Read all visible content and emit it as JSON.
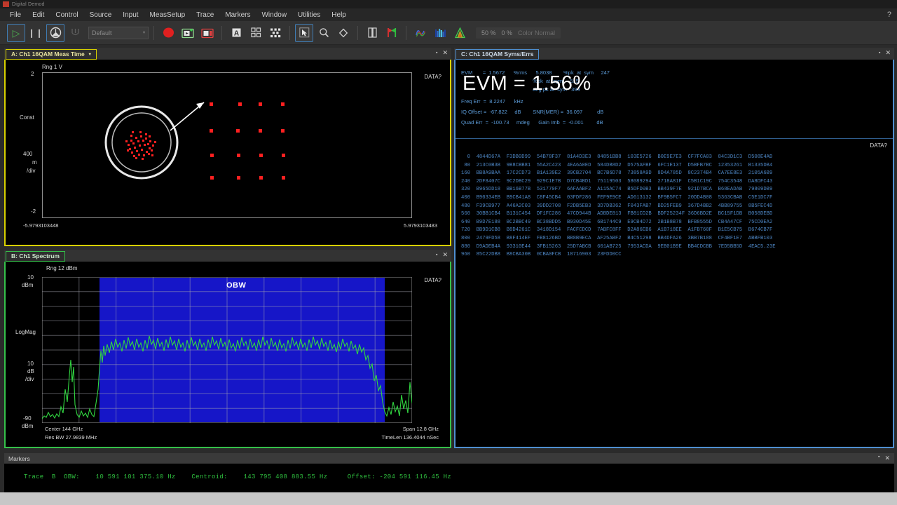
{
  "window": {
    "title": "Digital Demod",
    "logo_color": "#c0392b"
  },
  "menubar": {
    "items": [
      "File",
      "Edit",
      "Control",
      "Source",
      "Input",
      "MeasSetup",
      "Trace",
      "Markers",
      "Window",
      "Utilities",
      "Help"
    ],
    "help_icon": "?"
  },
  "toolbar": {
    "buttons": [
      {
        "name": "run-button",
        "glyph": "▷",
        "selected": true,
        "color": "#4caf50"
      },
      {
        "name": "pause-button",
        "glyph": "❙❙",
        "selected": false,
        "color": "#b8b8b8"
      },
      {
        "name": "single-button",
        "glyph": "⏺",
        "selected": true,
        "color": "#e0e0e0"
      },
      {
        "name": "restart-button",
        "glyph": "⟲",
        "selected": false,
        "color": "#6e6e6e"
      }
    ],
    "preset_combo": {
      "value": "Default",
      "placeholder": "Default",
      "arrow": "▾"
    },
    "record_button": {
      "name": "record-button",
      "glyph": "●",
      "color": "#e02020"
    },
    "capture_button": {
      "name": "capture-button",
      "glyph": "▣",
      "color": "#8fdc8f"
    },
    "stop_record_button": {
      "name": "stop-record-button",
      "glyph": "▣",
      "color": "#e04040"
    },
    "marker_button": {
      "name": "marker-letter-button",
      "glyph": "A"
    },
    "grid_button": {
      "name": "grid-layout-button",
      "glyph": "⠿"
    },
    "trace_button": {
      "name": "trace-points-button",
      "glyph": "⣿"
    },
    "pointer_button": {
      "name": "pointer-tool-button",
      "glyph": "↖",
      "selected": true
    },
    "zoom_button": {
      "name": "zoom-tool-button",
      "glyph": "⚲"
    },
    "marker_diamond": {
      "name": "marker-diamond-button",
      "glyph": "◇"
    },
    "bar_button": {
      "name": "bar-meas-button",
      "glyph": "▯"
    },
    "flag_button": {
      "name": "flag-marker-button",
      "glyph": "⌶"
    },
    "wave_button": {
      "name": "waveform-view-button",
      "glyph": "∿"
    },
    "spectrum_button": {
      "name": "spectrum-view-button",
      "glyph": "▥"
    },
    "peak_button": {
      "name": "peak-view-button",
      "glyph": "▲"
    },
    "readout": {
      "value1": "50 %",
      "value2": "0 %",
      "label": "Color Normal"
    }
  },
  "panel_a": {
    "title": "A: Ch1 16QAM Meas Time",
    "tab_arrow": "▾",
    "minimize": "▪",
    "close": "✕",
    "range_label": "Rng 1 V",
    "y_top": "2",
    "y_bottom": "-2",
    "y_name": "Const",
    "y_div_value": "400",
    "y_div_unit_1": "m",
    "y_div_unit_2": "/div",
    "x_left": "-5.9793103448",
    "x_right": "5.9793103483",
    "data_marker": "DATA?"
  },
  "panel_b": {
    "title": "B: Ch1 Spectrum",
    "minimize": "▪",
    "close": "✕",
    "range_label": "Rng 12 dBm",
    "y_top": "10",
    "y_top_unit": "dBm",
    "y_name": "LogMag",
    "y_div_value": "10",
    "y_div_unit_1": "dB",
    "y_div_unit_2": "/div",
    "y_bottom": "-90",
    "y_bottom_unit": "dBm",
    "band_label": "OBW",
    "data_marker": "DATA?",
    "x_center": "Center 144 GHz",
    "x_span": "Span 12.8 GHz",
    "x_resbw": "Res BW 27.9839 MHz",
    "x_timelen": "TimeLen 136.4044 nSec"
  },
  "panel_c": {
    "title": "C: Ch1 16QAM Syms/Errs",
    "minimize": "▪",
    "close": "✕",
    "data_marker": "DATA?",
    "big_readout": "EVM = 1.56%",
    "metrics": [
      {
        "label": "EVM",
        "eq": "=",
        "value": "1.5672",
        "unit": "%rms",
        "extra_label": "%pk  at  sym",
        "extra_value": "5.8038",
        "extra2": "247"
      },
      {
        "label": "",
        "eq": "",
        "value": "",
        "unit": "",
        "extra_label": "%pk  at  sym",
        "extra_value": "",
        "extra2": "515"
      },
      {
        "label": "",
        "eq": "",
        "value": "",
        "unit": "",
        "extra_label": "deg pk at  sym",
        "extra_value": "",
        "extra2": "399"
      },
      {
        "label": "Freq Err",
        "eq": "=",
        "value": "8.2247",
        "unit": "kHz",
        "extra_label": "",
        "extra_value": "",
        "extra2": ""
      },
      {
        "label": "IQ Offset",
        "eq": "=",
        "value": "-67.822",
        "unit": "dB",
        "extra_label": "SNR(MER) =  36.097",
        "extra_value": "dB",
        "extra2": ""
      },
      {
        "label": "Quad Err",
        "eq": "=",
        "value": "-100.73",
        "unit": "mdeg",
        "extra_label": "Gain Imb  =  -0.001",
        "extra_value": "dB",
        "extra2": ""
      }
    ],
    "metric_rows_raw": [
      "EVM       =  1.5672      %rms      5.8038        %pk  at  sym     247",
      "                                                 %pk  at  sym     515",
      "                                                 deg pk at  sym   399",
      "Freq Err  =  8.2247      kHz",
      "IQ Offset =  -67.822     dB        SNR(MER) =  36.097          dB",
      "Quad Err  =  -100.73     mdeg      Gain Imb  =  -0.001         dB"
    ],
    "hex_rows": [
      "  0  4844D67A  F3DB0D99  54B78F37  81A4D3E3  84851BB8  103E5726  B0E9E7E3  CF7FCA03  84C3D1C3  D508E4AD",
      " 80  213C0B3B  9B8CBB81  55A2C423  4EA6A0ED  584DB8D2  D575AFBF  6FC1E137  D5BFB7BC  12353261  B1335DB4",
      "160  BB8A9BAA  17C2CD73  B1A139E2  39CB2704  BC7B6D78  73858A9D  8D4A785D  8C2374B4  CA7EE8E3  2105A6B9",
      "240  2DF8407C  9C2DBC29  929C1E7B  D7CB4BD1  75119503  58089294  2718A81F  C5B1C19C  754C3548  DA8DFC43",
      "320  B965DD18  BB16B77B  531770F7  6AFAABF2  A115AC74  B5DFD0B3  BB439F7E  921D7BCA  B68EADAB  79809DB9",
      "400  B90334EB  B9CB41A8  C8F45CB4  03FDF286  FEF9E9CE  AD613132  BF9B5FC7  20DD4B08  5363CBAB  C5E1DC7F",
      "480  F39CB977  A46A2C03  39DD2708  F2DB5EB3  3D7DB362  F043FAB7  BD25FEB9  367D4BB2  4BB89755  8B5FEC4D",
      "560  30BB1CB4  B131C454  DF1FC286  47CD944B  ADBDE813  FB81CD2B  BDF25234F 36D6BD2E  BC15F1DB  B058DEBD",
      "640  B9D7E188  BC2BBC49  BC38BDD5  B930D45E  6B1744C9  E9CB4D72  2B1B8B78  BFB8555D  CB4A47CF  75CD0EA2",
      "720  BB9D1CB8  B8D4261C  3418D154  FACFCDCD  7ABFC8FF  D2A86EB6  A1B718EE  A1FB760F  B1E5CB75  B674CB7F",
      "800  2479FD58  B8F414EF  FB8126BD  BB8B9ECA  AF25ABF2  B4C51298  BB4DFA26  3BB7B188  CF4BF1E7  ABBFB103",
      "880  D9ADEB4A  93310E44  3FB15263  25D7ABCB  601AB725  7953ACDA  9EB01B9E  BB4CDCBB  7ED5BB5D  4EAC5.23E",
      "960  85C22DB8  B8CBA30B  0CBA0FCB  18716903  23FDD0CC"
    ]
  },
  "markers": {
    "title": "Markers",
    "minimize": "▪",
    "close": "✕",
    "line": "Trace  B  OBW:    10 591 101 375.10 Hz    Centroid:    143 795 408 883.55 Hz     Offset: -204 591 116.45 Hz"
  },
  "colors": {
    "accent_yellow": "#d8d100",
    "accent_green": "#35c04a",
    "accent_blue": "#4f8fd0",
    "constellation_red": "#ff2020",
    "spectrum_green": "#31d641",
    "obw_blue": "#1616c8",
    "marker_green": "#2fbf3f"
  },
  "chart_data": [
    {
      "type": "scatter",
      "title": "A: Ch1 16QAM Meas Time",
      "ylabel": "Const",
      "ylim": [
        -2,
        2
      ],
      "xlim": [
        -5.9793103448,
        5.9793103483
      ],
      "grid": false,
      "note": "16QAM constellation, 4x4 grid of symbol clusters; lower-left cluster magnified via circular callout",
      "symbol_grid_rows": 4,
      "symbol_grid_cols": 4,
      "points": [
        [
          -1.5,
          1.5
        ],
        [
          -0.5,
          1.5
        ],
        [
          0.5,
          1.5
        ],
        [
          1.5,
          1.5
        ],
        [
          -1.5,
          0.5
        ],
        [
          -0.5,
          0.5
        ],
        [
          0.5,
          0.5
        ],
        [
          1.5,
          0.5
        ],
        [
          -1.5,
          -0.5
        ],
        [
          -0.5,
          -0.5
        ],
        [
          0.5,
          -0.5
        ],
        [
          1.5,
          -0.5
        ],
        [
          -1.5,
          -1.5
        ],
        [
          -0.5,
          -1.5
        ],
        [
          0.5,
          -1.5
        ],
        [
          1.5,
          -1.5
        ]
      ]
    },
    {
      "type": "line",
      "title": "B: Ch1 Spectrum",
      "xlabel": "Center 144 GHz / Span 12.8 GHz",
      "ylabel": "LogMag",
      "ylim": [
        -90,
        10
      ],
      "y_div": 10,
      "y_unit": "dBm",
      "grid": true,
      "annotation": "OBW",
      "occupied_band_fraction": [
        0.155,
        0.925
      ],
      "noise_floor_dbm": -75,
      "signal_level_dbm": -30
    }
  ]
}
